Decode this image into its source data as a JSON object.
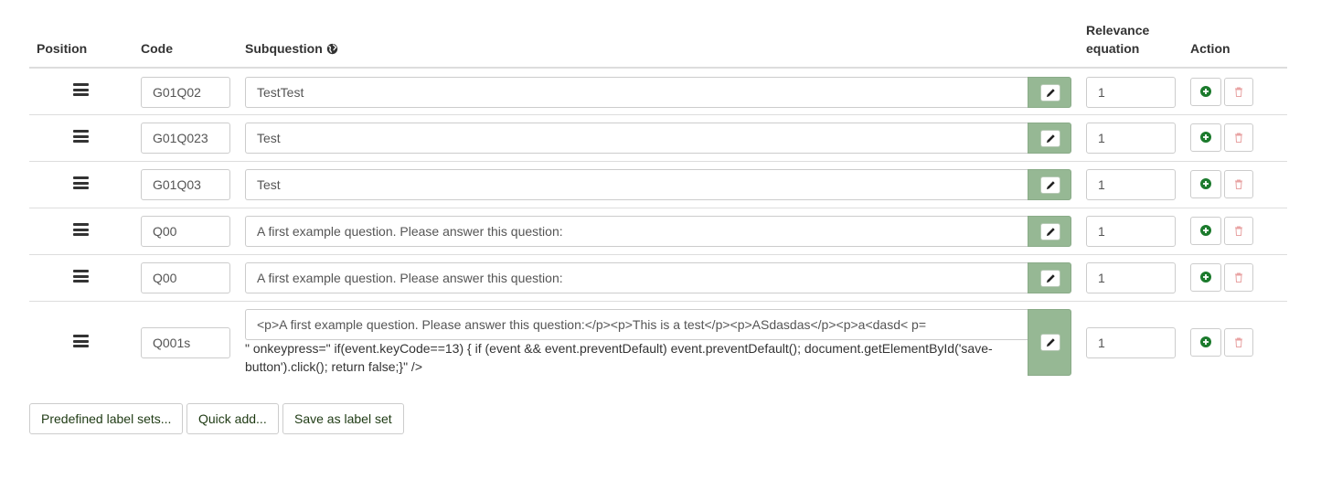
{
  "table": {
    "headers": {
      "position": "Position",
      "code": "Code",
      "subquestion": "Subquestion",
      "relevance_line1": "Relevance",
      "relevance_line2": "equation",
      "action": "Action"
    },
    "rows": [
      {
        "code": "G01Q02",
        "subquestion": "TestTest",
        "relevance": "1"
      },
      {
        "code": "G01Q023",
        "subquestion": "Test",
        "relevance": "1"
      },
      {
        "code": "G01Q03",
        "subquestion": "Test",
        "relevance": "1"
      },
      {
        "code": "Q00",
        "subquestion": "A first example question. Please answer this question:",
        "relevance": "1"
      },
      {
        "code": "Q00",
        "subquestion": "A first example question. Please answer this question:",
        "relevance": "1"
      },
      {
        "code": "Q001s",
        "subquestion": "<p>A first example question. Please answer this question:</p><p>This is a test</p><p>ASdasdas</p><p>a<dasd< p=",
        "overflow_text": "\" onkeypress=\" if(event.keyCode==13) { if (event && event.preventDefault) event.preventDefault(); document.getElementById('save-button').click(); return false;}\" />",
        "relevance": "1"
      }
    ]
  },
  "footer": {
    "predefined_label": "Predefined label sets...",
    "quick_add_label": "Quick add...",
    "save_label_set_label": "Save as label set"
  },
  "icons": {
    "drag": "bars-icon",
    "globe": "globe-icon",
    "edit": "pencil-icon",
    "add": "plus-circle-icon",
    "delete": "trash-icon"
  },
  "colors": {
    "edit_addon": "#96b894",
    "add_icon": "#1b7a2c",
    "delete_icon": "#e8a3a3",
    "footer_text": "#1e3a13"
  }
}
